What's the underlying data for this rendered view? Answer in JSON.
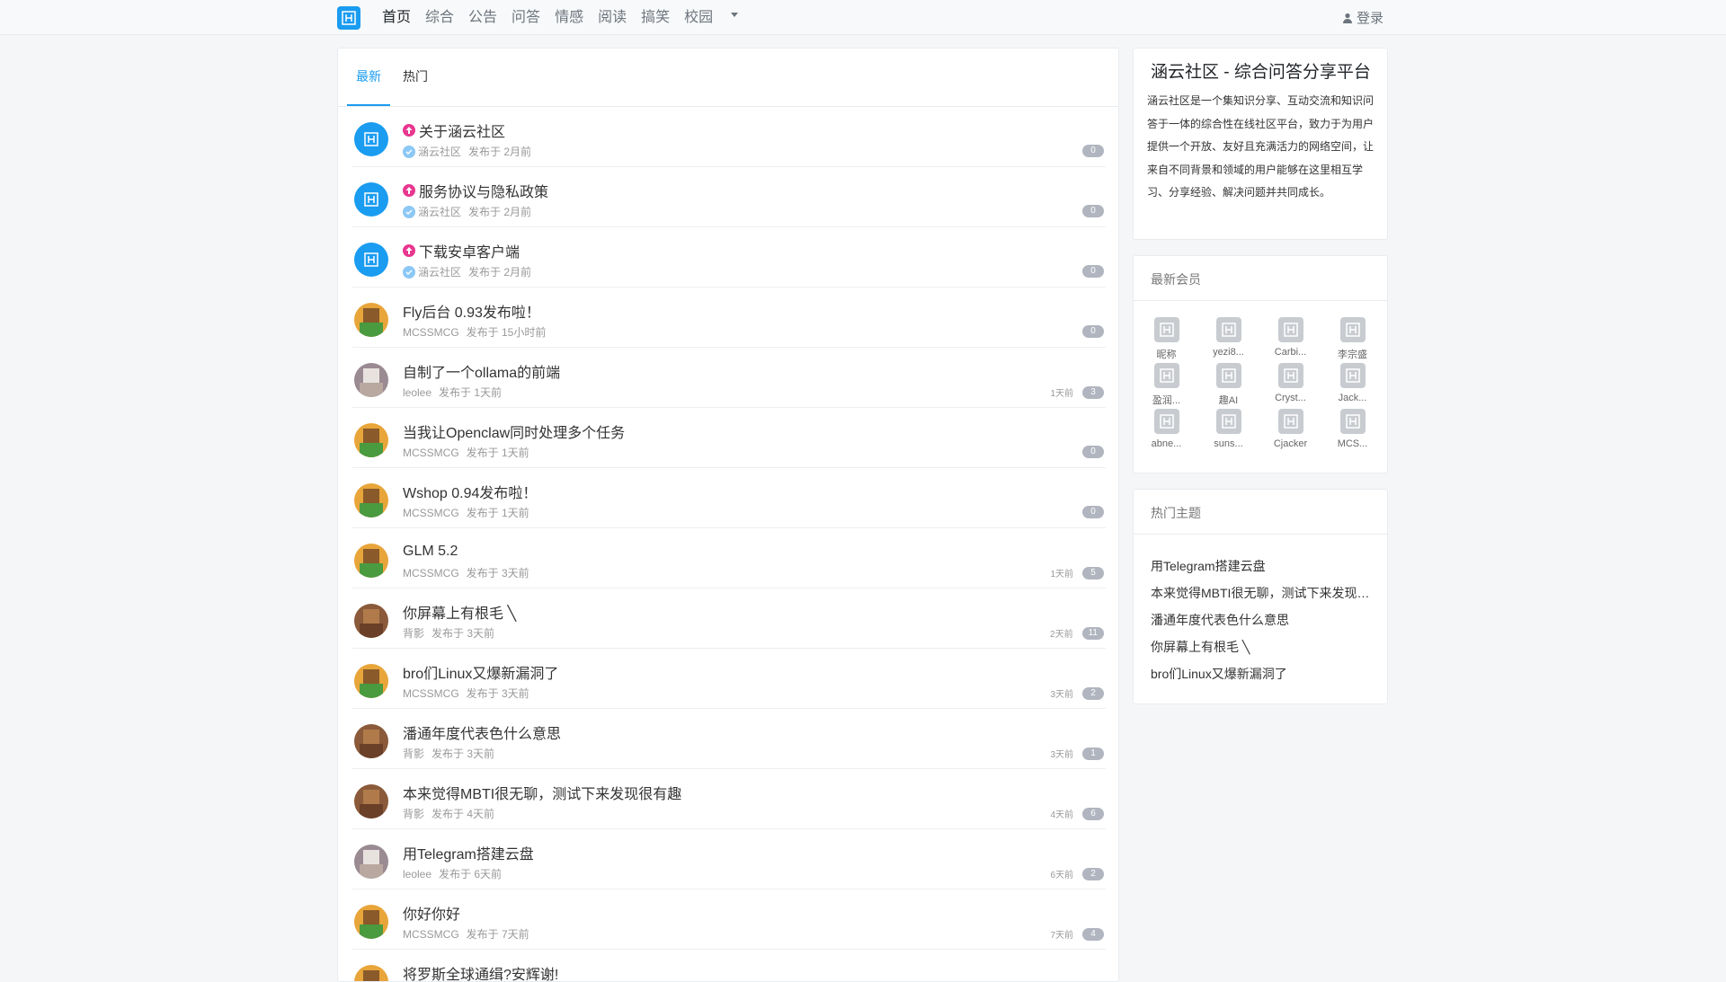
{
  "nav": {
    "items": [
      "首页",
      "综合",
      "公告",
      "问答",
      "情感",
      "阅读",
      "搞笑",
      "校园"
    ],
    "login": "登录"
  },
  "tabs": [
    "最新",
    "热门"
  ],
  "topics": [
    {
      "title": "关于涵云社区",
      "author": "涵云社区",
      "posted": "发布于 2月前",
      "time": "",
      "count": "0",
      "pinned": true,
      "avatar": "site"
    },
    {
      "title": "服务协议与隐私政策",
      "author": "涵云社区",
      "posted": "发布于 2月前",
      "time": "",
      "count": "0",
      "pinned": true,
      "avatar": "site"
    },
    {
      "title": "下载安卓客户端",
      "author": "涵云社区",
      "posted": "发布于 2月前",
      "time": "",
      "count": "0",
      "pinned": true,
      "avatar": "site"
    },
    {
      "title": "Fly后台 0.93发布啦！",
      "author": "MCSSMCG",
      "posted": "发布于 15小时前",
      "time": "",
      "count": "0",
      "pinned": false,
      "avatar": "mc"
    },
    {
      "title": "自制了一个ollama的前端",
      "author": "leolee",
      "posted": "发布于 1天前",
      "time": "1天前",
      "count": "3",
      "pinned": false,
      "avatar": "leo"
    },
    {
      "title": "当我让Openclaw同时处理多个任务",
      "author": "MCSSMCG",
      "posted": "发布于 1天前",
      "time": "",
      "count": "0",
      "pinned": false,
      "avatar": "mc"
    },
    {
      "title": "Wshop 0.94发布啦！",
      "author": "MCSSMCG",
      "posted": "发布于 1天前",
      "time": "",
      "count": "0",
      "pinned": false,
      "avatar": "mc"
    },
    {
      "title": "GLM 5.2",
      "author": "MCSSMCG",
      "posted": "发布于 3天前",
      "time": "1天前",
      "count": "5",
      "pinned": false,
      "avatar": "mc"
    },
    {
      "title": "你屏幕上有根毛 ╲",
      "author": "背影",
      "posted": "发布于 3天前",
      "time": "2天前",
      "count": "11",
      "pinned": false,
      "avatar": "bei"
    },
    {
      "title": "bro们Linux又爆新漏洞了",
      "author": "MCSSMCG",
      "posted": "发布于 3天前",
      "time": "3天前",
      "count": "2",
      "pinned": false,
      "avatar": "mc"
    },
    {
      "title": "潘通年度代表色什么意思",
      "author": "背影",
      "posted": "发布于 3天前",
      "time": "3天前",
      "count": "1",
      "pinned": false,
      "avatar": "bei"
    },
    {
      "title": "本来觉得MBTI很无聊，测试下来发现很有趣",
      "author": "背影",
      "posted": "发布于 4天前",
      "time": "4天前",
      "count": "6",
      "pinned": false,
      "avatar": "bei"
    },
    {
      "title": "用Telegram搭建云盘",
      "author": "leolee",
      "posted": "发布于 6天前",
      "time": "6天前",
      "count": "2",
      "pinned": false,
      "avatar": "leo"
    },
    {
      "title": "你好你好",
      "author": "MCSSMCG",
      "posted": "发布于 7天前",
      "time": "7天前",
      "count": "4",
      "pinned": false,
      "avatar": "mc"
    },
    {
      "title": "将罗斯全球通缉?安辉谢!",
      "author": "",
      "posted": "",
      "time": "",
      "count": "",
      "pinned": false,
      "avatar": "mc"
    }
  ],
  "about": {
    "title": "涵云社区 - 综合问答分享平台",
    "text": "涵云社区是一个集知识分享、互动交流和知识问答于一体的综合性在线社区平台，致力于为用户提供一个开放、友好且充满活力的网络空间，让来自不同背景和领域的用户能够在这里相互学习、分享经验、解决问题并共同成长。"
  },
  "members": {
    "title": "最新会员",
    "items": [
      "昵称",
      "yezi8...",
      "Carbi...",
      "李宗盛",
      "盈润...",
      "趣AI",
      "Cryst...",
      "Jack...",
      "abne...",
      "suns...",
      "Cjacker",
      "MCS..."
    ]
  },
  "hot": {
    "title": "热门主题",
    "items": [
      "用Telegram搭建云盘",
      "本来觉得MBTI很无聊，测试下来发现很有趣",
      "潘通年度代表色什么意思",
      "你屏幕上有根毛 ╲",
      "bro们Linux又爆新漏洞了"
    ]
  },
  "icons": {
    "logo": "site-logo-icon",
    "login": "user-icon",
    "pin": "arrow-up-icon",
    "dropdown": "caret-down-icon"
  },
  "colors": {
    "accent": "#1a9cf0",
    "pin": "#e8368f",
    "count": "#b0b5bf"
  }
}
